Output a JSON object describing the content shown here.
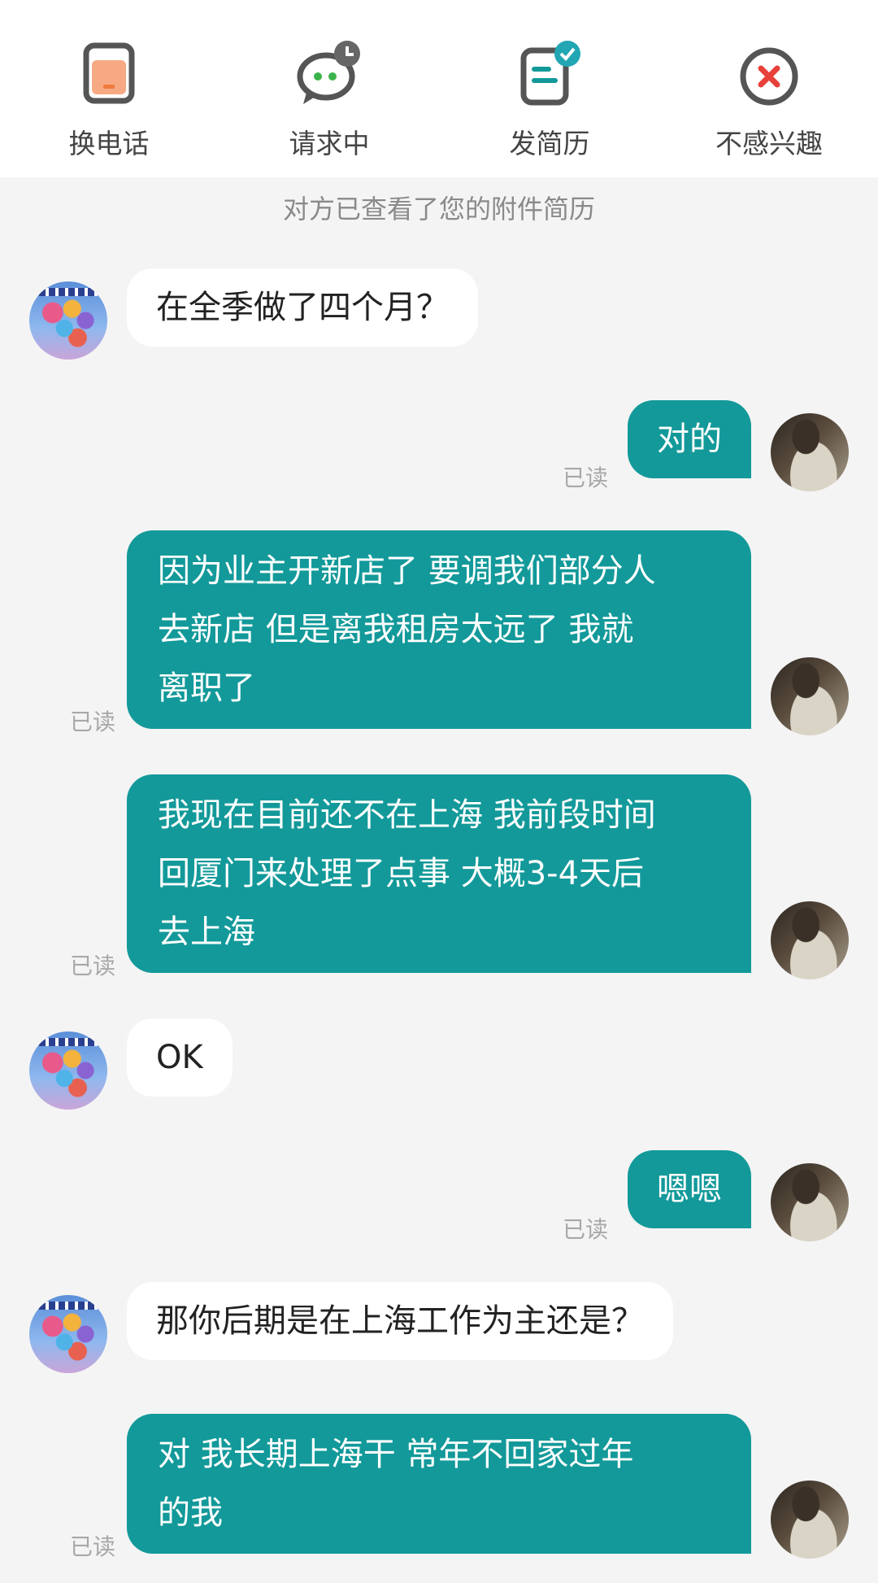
{
  "top_actions": [
    {
      "label": "换电话",
      "icon": "phone-card-icon"
    },
    {
      "label": "请求中",
      "icon": "chat-pending-icon"
    },
    {
      "label": "发简历",
      "icon": "resume-sent-icon"
    },
    {
      "label": "不感兴趣",
      "icon": "not-interested-icon"
    }
  ],
  "notice": "对方已查看了您的附件简历",
  "read_label": "已读",
  "messages": [
    {
      "side": "in",
      "text": "在全季做了四个月？"
    },
    {
      "side": "out",
      "text": "对的",
      "status": "已读"
    },
    {
      "side": "out",
      "lines": [
        "因为业主开新店了 要调我们部分人",
        "去新店 但是离我租房太远了 我就",
        "离职了"
      ],
      "status": "已读"
    },
    {
      "side": "out",
      "lines": [
        "我现在目前还不在上海 我前段时间",
        "回厦门来处理了点事 大概3-4天后",
        "去上海"
      ],
      "status": "已读"
    },
    {
      "side": "in",
      "text": "OK"
    },
    {
      "side": "out",
      "text": "嗯嗯",
      "status": "已读"
    },
    {
      "side": "in",
      "text": "那你后期是在上海工作为主还是？"
    },
    {
      "side": "out",
      "lines": [
        "对 我长期上海干 常年不回家过年",
        "的我"
      ],
      "status": "已读"
    }
  ],
  "colors": {
    "outgoing_bubble": "#13999a",
    "incoming_bubble": "#ffffff",
    "background": "#f4f4f4",
    "accent_orange": "#f07a3c",
    "accent_green": "#3bb34a",
    "accent_red": "#e8403a"
  }
}
